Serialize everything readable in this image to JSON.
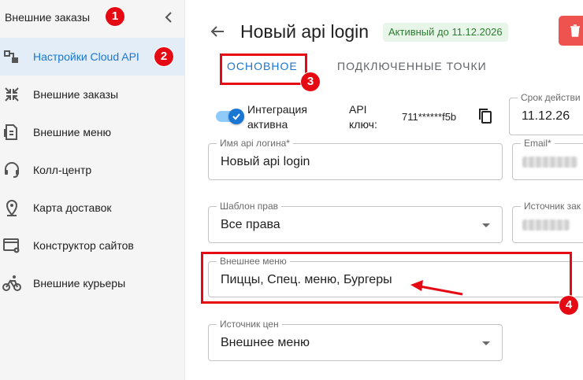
{
  "sidebar": {
    "title": "Внешние заказы",
    "items": [
      {
        "label": "Настройки Cloud API",
        "icon": "cloud-api-settings-icon",
        "active": true
      },
      {
        "label": "Внешние заказы",
        "icon": "external-orders-icon",
        "active": false
      },
      {
        "label": "Внешние меню",
        "icon": "external-menu-icon",
        "active": false
      },
      {
        "label": "Колл-центр",
        "icon": "headset-icon",
        "active": false
      },
      {
        "label": "Карта доставок",
        "icon": "map-pin-icon",
        "active": false
      },
      {
        "label": "Конструктор сайтов",
        "icon": "site-builder-icon",
        "active": false
      },
      {
        "label": "Внешние курьеры",
        "icon": "bicycle-courier-icon",
        "active": false
      }
    ]
  },
  "header": {
    "title": "Новый api login",
    "status": "Активный до 11.12.2026"
  },
  "tabs": [
    {
      "label": "Основное",
      "active": true
    },
    {
      "label": "Подключенные точки",
      "active": false
    }
  ],
  "form": {
    "integration_label": "Интеграция активна",
    "integration_enabled": true,
    "api_key_label": "API ключ:",
    "api_key_value": "711******f5b",
    "expiry_label": "Срок действи",
    "expiry_value": "11.12.26",
    "login_name_label": "Имя api логина*",
    "login_name_value": "Новый api login",
    "email_label": "Email*",
    "rights_label": "Шаблон прав",
    "rights_value": "Все права",
    "source_label": "Источник зак",
    "external_menu_label": "Внешнее меню",
    "external_menu_value": "Пиццы, Спец. меню, Бургеры",
    "price_source_label": "Источник цен",
    "price_source_value": "Внешнее меню"
  },
  "annotations": {
    "badge_1": "1",
    "badge_2": "2",
    "badge_3": "3",
    "badge_4": "4"
  },
  "colors": {
    "accent": "#1976d2",
    "annotation": "#e50914",
    "status_green": "#2e7d32",
    "danger": "#ef5350"
  }
}
